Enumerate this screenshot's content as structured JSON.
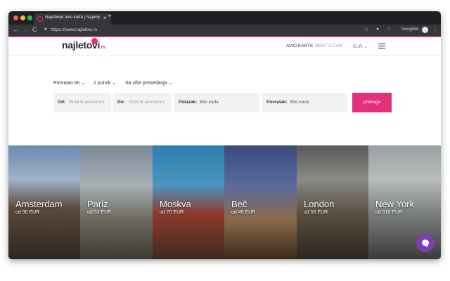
{
  "browser": {
    "tab_title": "Najeftinije avio karte | Najbolje",
    "tab_close": "×",
    "new_tab": "+",
    "url": "https://www.najletovi.rs",
    "incognito_label": "Incognito",
    "nav_back": "←",
    "nav_forward": "→",
    "nav_reload": "C"
  },
  "header": {
    "logo_text": "najletovi",
    "logo_suffix": ".rs",
    "nav_flights": "AVIO KARTE",
    "nav_rent": "RENT A CAR",
    "currency": "EUR"
  },
  "search": {
    "trip_type": "Povratan let",
    "passengers": "1 putnik",
    "stops": "Sa više presedanja",
    "from_label": "Od:",
    "from_placeholder": "Grad ili aerodrom",
    "to_label": "Do:",
    "to_placeholder": "Grad ili aerodrom",
    "depart_label": "Polazak:",
    "depart_value": "Bilo kada",
    "return_label": "Povratak:",
    "return_value": "Bilo kada",
    "button": "pretraga"
  },
  "destinations": [
    {
      "city": "Amsterdam",
      "price": "od 90 EUR"
    },
    {
      "city": "Pariz",
      "price": "od 53 EUR"
    },
    {
      "city": "Moskva",
      "price": "od 70 EUR"
    },
    {
      "city": "Beč",
      "price": "od 45 EUR"
    },
    {
      "city": "London",
      "price": "od 55 EUR"
    },
    {
      "city": "New York",
      "price": "od 310 EUR"
    }
  ],
  "colors": {
    "brand_pink": "#e3307a",
    "chat_purple": "#7b3fb0"
  }
}
